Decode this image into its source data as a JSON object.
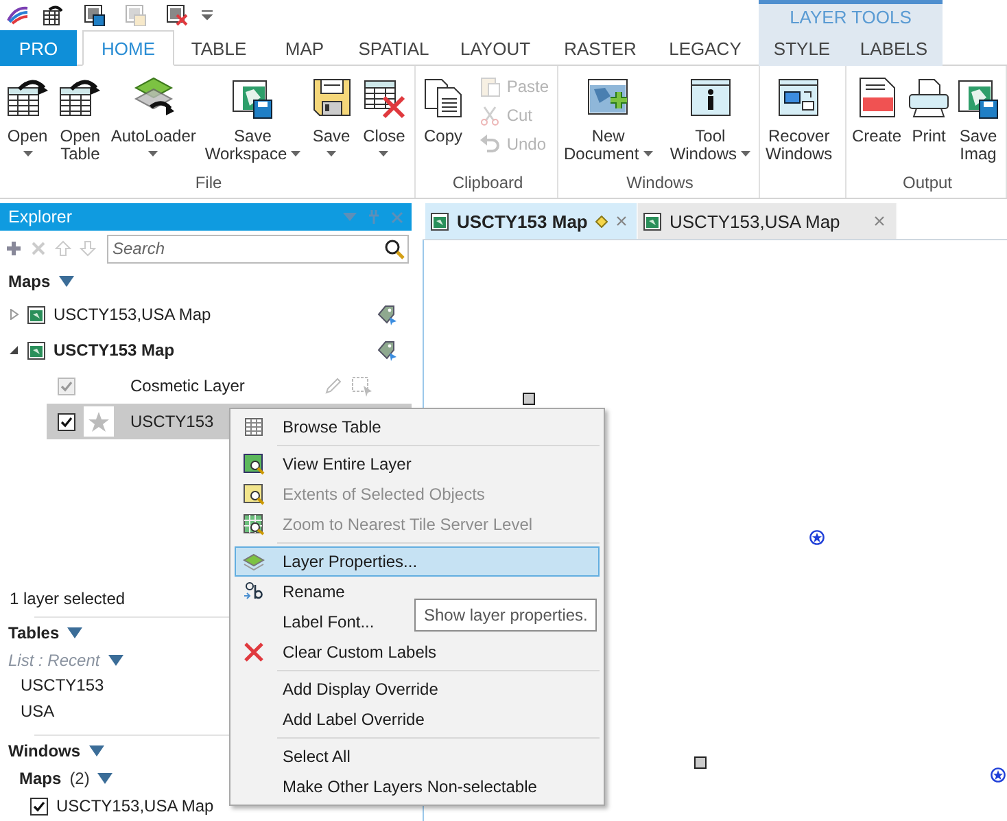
{
  "quick_access": [
    {
      "disabled": false
    },
    {
      "disabled": false
    },
    {
      "disabled": true
    },
    {
      "disabled": false
    }
  ],
  "contextual_group": {
    "title": "LAYER TOOLS"
  },
  "ribbon_tabs": [
    {
      "label": "PRO",
      "kind": "backstage",
      "selected": false
    },
    {
      "label": "HOME",
      "kind": "normal",
      "selected": true
    },
    {
      "label": "TABLE",
      "kind": "normal",
      "selected": false
    },
    {
      "label": "MAP",
      "kind": "normal",
      "selected": false
    },
    {
      "label": "SPATIAL",
      "kind": "normal",
      "selected": false
    },
    {
      "label": "LAYOUT",
      "kind": "normal",
      "selected": false
    },
    {
      "label": "RASTER",
      "kind": "normal",
      "selected": false
    },
    {
      "label": "LEGACY",
      "kind": "normal",
      "selected": false
    },
    {
      "label": "STYLE",
      "kind": "contextual",
      "selected": false
    },
    {
      "label": "LABELS",
      "kind": "contextual",
      "selected": false
    }
  ],
  "ribbon_groups": [
    {
      "label": "File",
      "buttons": [
        {
          "label": "Open",
          "kind": "large",
          "dropdown": true,
          "caret_inline": false,
          "disabled": false
        },
        {
          "label": "Open\nTable",
          "kind": "large",
          "dropdown": false,
          "disabled": false
        },
        {
          "label": "AutoLoader",
          "kind": "large",
          "dropdown": true,
          "caret_inline": false,
          "disabled": false
        },
        {
          "label": "Save\nWorkspace",
          "kind": "large",
          "dropdown": true,
          "caret_inline": true,
          "disabled": false
        },
        {
          "label": "Save",
          "kind": "large",
          "dropdown": true,
          "caret_inline": false,
          "disabled": false
        },
        {
          "label": "Close",
          "kind": "large",
          "dropdown": true,
          "caret_inline": false,
          "disabled": false
        }
      ]
    },
    {
      "label": "Clipboard",
      "buttons": [
        {
          "label": "Copy",
          "kind": "large",
          "dropdown": false,
          "disabled": false
        },
        {
          "label": "Paste",
          "kind": "small",
          "disabled": true
        },
        {
          "label": "Cut",
          "kind": "small",
          "disabled": true
        },
        {
          "label": "Undo",
          "kind": "small",
          "disabled": true
        }
      ]
    },
    {
      "label": "Windows",
      "buttons": [
        {
          "label": "New\nDocument",
          "kind": "large",
          "dropdown": true,
          "caret_inline": true,
          "disabled": false
        },
        {
          "label": "Tool\nWindows",
          "kind": "large",
          "dropdown": true,
          "caret_inline": true,
          "disabled": false
        }
      ]
    },
    {
      "buttons": [
        {
          "label": "Recover\nWindows",
          "kind": "large",
          "dropdown": false,
          "disabled": false
        }
      ]
    },
    {
      "label": "Output",
      "buttons": [
        {
          "label": "Create",
          "kind": "large",
          "dropdown": false,
          "disabled": false
        },
        {
          "label": "Print",
          "kind": "large",
          "dropdown": false,
          "disabled": false
        },
        {
          "label": "Save\nImag",
          "kind": "large",
          "dropdown": false,
          "disabled": false
        }
      ]
    }
  ],
  "explorer": {
    "title": "Explorer",
    "search": {
      "placeholder": "Search"
    },
    "maps_heading": "Maps",
    "maps": [
      {
        "label": "USCTY153,USA Map",
        "expanded": false,
        "active": false
      },
      {
        "label": "USCTY153 Map",
        "expanded": true,
        "active": true,
        "children": [
          {
            "label": "Cosmetic Layer",
            "kind": "cosmetic",
            "checked": true,
            "disabled": true,
            "selected": false
          },
          {
            "label": "USCTY153",
            "kind": "layer",
            "checked": true,
            "disabled": false,
            "selected": true
          }
        ]
      }
    ],
    "status": "1 layer selected",
    "tables": {
      "heading": "Tables",
      "list_mode": "List : Recent",
      "items": [
        "USCTY153",
        "USA"
      ]
    },
    "windows": {
      "heading": "Windows",
      "groups": [
        {
          "label": "Maps",
          "count": "(2)",
          "items": [
            {
              "label": "USCTY153,USA Map",
              "checked": true
            }
          ]
        }
      ]
    }
  },
  "map_tabs": [
    {
      "label": "USCTY153 Map",
      "selected": true,
      "modified": true
    },
    {
      "label": "USCTY153,USA Map",
      "selected": false,
      "modified": false
    }
  ],
  "map_points": [
    {
      "kind": "square"
    },
    {
      "kind": "star"
    },
    {
      "kind": "square"
    },
    {
      "kind": "star"
    }
  ],
  "context_menu": {
    "sections": [
      [
        {
          "label": "Browse Table",
          "disabled": false,
          "selected": false
        }
      ],
      [
        {
          "label": "View Entire Layer",
          "disabled": false,
          "selected": false
        },
        {
          "label": "Extents of Selected Objects",
          "disabled": true,
          "selected": false
        },
        {
          "label": "Zoom to Nearest Tile Server Level",
          "disabled": true,
          "selected": false
        }
      ],
      [
        {
          "label": "Layer Properties...",
          "disabled": false,
          "selected": true
        },
        {
          "label": "Rename",
          "disabled": false,
          "selected": false
        },
        {
          "label": "Label Font...",
          "disabled": false,
          "selected": false
        },
        {
          "label": "Clear Custom Labels",
          "disabled": false,
          "selected": false
        }
      ],
      [
        {
          "label": "Add Display Override",
          "disabled": false,
          "selected": false
        },
        {
          "label": "Add Label Override",
          "disabled": false,
          "selected": false
        }
      ],
      [
        {
          "label": "Select All",
          "disabled": false,
          "selected": false
        },
        {
          "label": "Make Other Layers Non-selectable",
          "disabled": false,
          "selected": false
        }
      ]
    ]
  },
  "tooltip": {
    "text": "Show layer properties."
  }
}
